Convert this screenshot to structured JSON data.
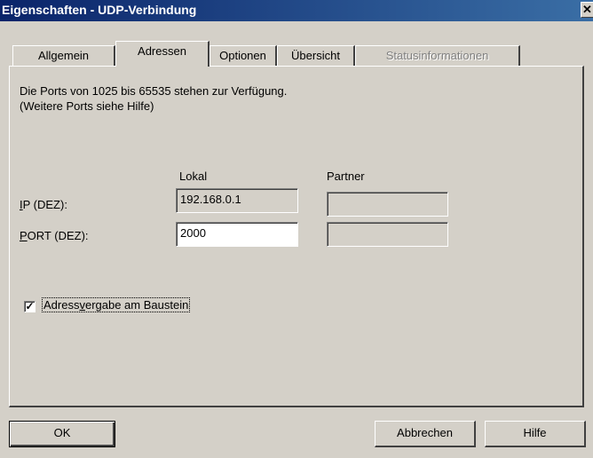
{
  "window": {
    "title": "Eigenschaften - UDP-Verbindung",
    "close_label": "✕"
  },
  "tabs": [
    {
      "label": "Allgemein",
      "state": "normal"
    },
    {
      "label": "Adressen",
      "state": "active"
    },
    {
      "label": "Optionen",
      "state": "normal"
    },
    {
      "label": "Übersicht",
      "state": "normal"
    },
    {
      "label": "Statusinformationen",
      "state": "disabled"
    }
  ],
  "info": {
    "line1": "Die Ports von 1025 bis 65535 stehen zur Verfügung.",
    "line2": "(Weitere Ports siehe Hilfe)"
  },
  "columns": {
    "local": "Lokal",
    "partner": "Partner"
  },
  "ip": {
    "label_mnemonic": "I",
    "label_rest": "P (DEZ):",
    "local_value": "192.168.0.1",
    "partner_value": ""
  },
  "port": {
    "label_mnemonic": "P",
    "label_rest": "ORT (DEZ):",
    "local_value": "2000",
    "partner_value": ""
  },
  "checkbox": {
    "checked": true,
    "check_glyph": "✓",
    "label_before": "Adress",
    "label_mnemonic": "v",
    "label_after": "ergabe am Baustein"
  },
  "buttons": {
    "ok": "OK",
    "cancel": "Abbrechen",
    "help": "Hilfe"
  }
}
